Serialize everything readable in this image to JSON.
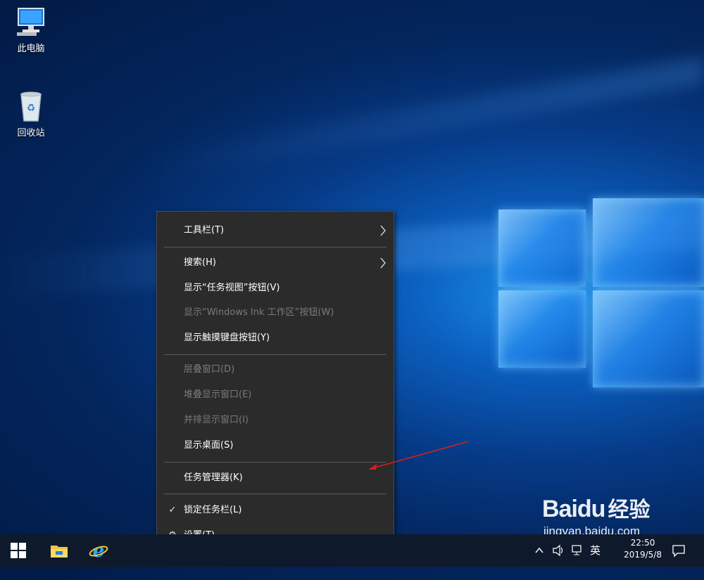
{
  "desktop": {
    "icons": [
      {
        "label": "此电脑",
        "icon": "computer-icon"
      },
      {
        "label": "回收站",
        "icon": "recycle-bin-icon"
      }
    ]
  },
  "context_menu": {
    "items": [
      {
        "label": "工具栏(T)",
        "enabled": true,
        "submenu": true
      },
      {
        "label": "搜索(H)",
        "enabled": true,
        "submenu": true
      },
      {
        "label": "显示“任务视图”按钮(V)",
        "enabled": true
      },
      {
        "label": "显示“Windows Ink 工作区”按钮(W)",
        "enabled": false
      },
      {
        "label": "显示触摸键盘按钮(Y)",
        "enabled": true
      },
      {
        "label": "层叠窗口(D)",
        "enabled": false
      },
      {
        "label": "堆叠显示窗口(E)",
        "enabled": false
      },
      {
        "label": "并排显示窗口(I)",
        "enabled": false
      },
      {
        "label": "显示桌面(S)",
        "enabled": true
      },
      {
        "label": "任务管理器(K)",
        "enabled": true
      },
      {
        "label": "锁定任务栏(L)",
        "enabled": true,
        "checked": true
      },
      {
        "label": "设置(T)",
        "enabled": true,
        "icon": "gear-icon"
      }
    ],
    "submenu_glyph": "〉",
    "check_glyph": "✓",
    "gear_glyph": "⚙"
  },
  "taskbar": {
    "start_icon": "windows-start-icon",
    "pinned": [
      "file-explorer-icon",
      "internet-explorer-icon"
    ],
    "tray": {
      "chevron": "^",
      "ime": "英",
      "time": "22:50",
      "date": "2019/5/8"
    }
  },
  "watermark": {
    "brand": "Baidu",
    "brand_cn": "经验",
    "url": "jingyan.baidu.com"
  },
  "colors": {
    "menu_bg": "#2b2b2b",
    "annotation_arrow": "#d81e1e"
  }
}
